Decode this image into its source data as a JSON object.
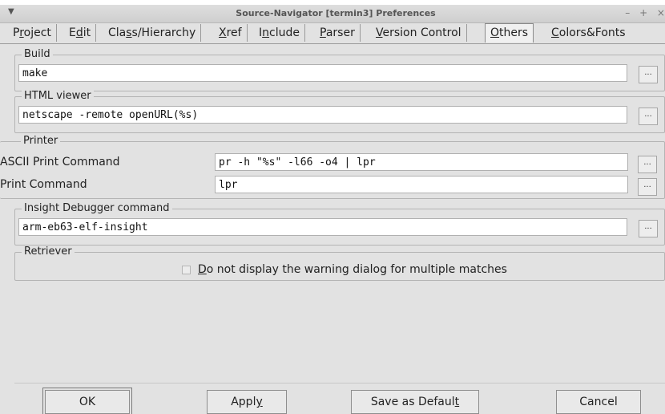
{
  "window": {
    "title": "Source-Navigator [termin3] Preferences",
    "controls": "– + ×"
  },
  "tabs": [
    {
      "label": "Project",
      "active": false
    },
    {
      "label": "Edit",
      "active": false
    },
    {
      "label": "Class/Hierarchy",
      "active": false
    },
    {
      "label": "Xref",
      "active": false
    },
    {
      "label": "Include",
      "active": false
    },
    {
      "label": "Parser",
      "active": false
    },
    {
      "label": "Version Control",
      "active": false
    },
    {
      "label": "Others",
      "active": true
    },
    {
      "label": "Colors&Fonts",
      "active": false
    }
  ],
  "build": {
    "label": "Build",
    "value": "make",
    "browse": "..."
  },
  "html_viewer": {
    "label": "HTML viewer",
    "value": "netscape -remote openURL(%s)",
    "browse": "..."
  },
  "printer": {
    "label": "Printer",
    "ascii_label": "ASCII Print Command",
    "ascii_value": "pr -h \"%s\" -l66 -o4 | lpr",
    "print_label": "Print Command",
    "print_value": "lpr",
    "browse": "..."
  },
  "debugger": {
    "label": "Insight Debugger command",
    "value": "arm-eb63-elf-insight",
    "browse": "..."
  },
  "retriever": {
    "label": "Retriever",
    "checkbox_label": "Do not display the warning dialog for multiple matches",
    "checked": false
  },
  "buttons": {
    "ok": "OK",
    "apply": "Apply",
    "save_default": "Save as Default",
    "cancel": "Cancel"
  }
}
